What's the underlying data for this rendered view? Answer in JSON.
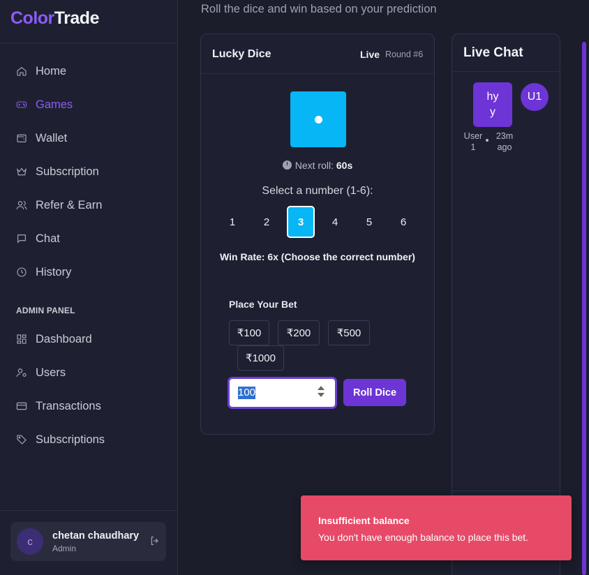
{
  "brand": {
    "part1": "Color",
    "part2": "Trade",
    "accent": "#8b5cf6"
  },
  "sidebar": {
    "items": [
      {
        "label": "Home",
        "icon": "home-icon"
      },
      {
        "label": "Games",
        "icon": "gamepad-icon",
        "active": true
      },
      {
        "label": "Wallet",
        "icon": "wallet-icon"
      },
      {
        "label": "Subscription",
        "icon": "crown-icon"
      },
      {
        "label": "Refer & Earn",
        "icon": "users-icon"
      },
      {
        "label": "Chat",
        "icon": "message-icon"
      },
      {
        "label": "History",
        "icon": "clock-icon"
      }
    ],
    "admin_title": "ADMIN PANEL",
    "admin_items": [
      {
        "label": "Dashboard",
        "icon": "dashboard-icon"
      },
      {
        "label": "Users",
        "icon": "user-cog-icon"
      },
      {
        "label": "Transactions",
        "icon": "card-icon"
      },
      {
        "label": "Subscriptions",
        "icon": "tag-icon"
      }
    ],
    "user": {
      "initial": "c",
      "name": "chetan chaudhary",
      "role": "Admin"
    }
  },
  "main": {
    "subtitle": "Roll the dice and win based on your prediction",
    "game": {
      "title": "Lucky Dice",
      "status": "Live",
      "round": "Round #6",
      "dice_value": 1,
      "dice_color": "#06b6f5",
      "next_roll_label": "Next roll:",
      "next_roll_value": "60s",
      "select_label": "Select a number (1-6):",
      "numbers": [
        "1",
        "2",
        "3",
        "4",
        "5",
        "6"
      ],
      "selected_number": "3",
      "win_rate": "Win Rate: 6x (Choose the correct number)",
      "bet_label": "Place Your Bet",
      "bet_chips": [
        "₹100",
        "₹200",
        "₹500",
        "₹1000"
      ],
      "bet_input_value": "100",
      "roll_button": "Roll Dice"
    }
  },
  "chat": {
    "title": "Live Chat",
    "messages": [
      {
        "text_line1": "hy",
        "text_line2": "y",
        "avatar": "U1",
        "user_line1": "User",
        "user_line2": "1",
        "time_line1": "23m",
        "time_line2": "ago"
      }
    ]
  },
  "toast": {
    "title": "Insufficient balance",
    "message": "You don't have enough balance to place this bet.",
    "color": "#e64a67"
  }
}
